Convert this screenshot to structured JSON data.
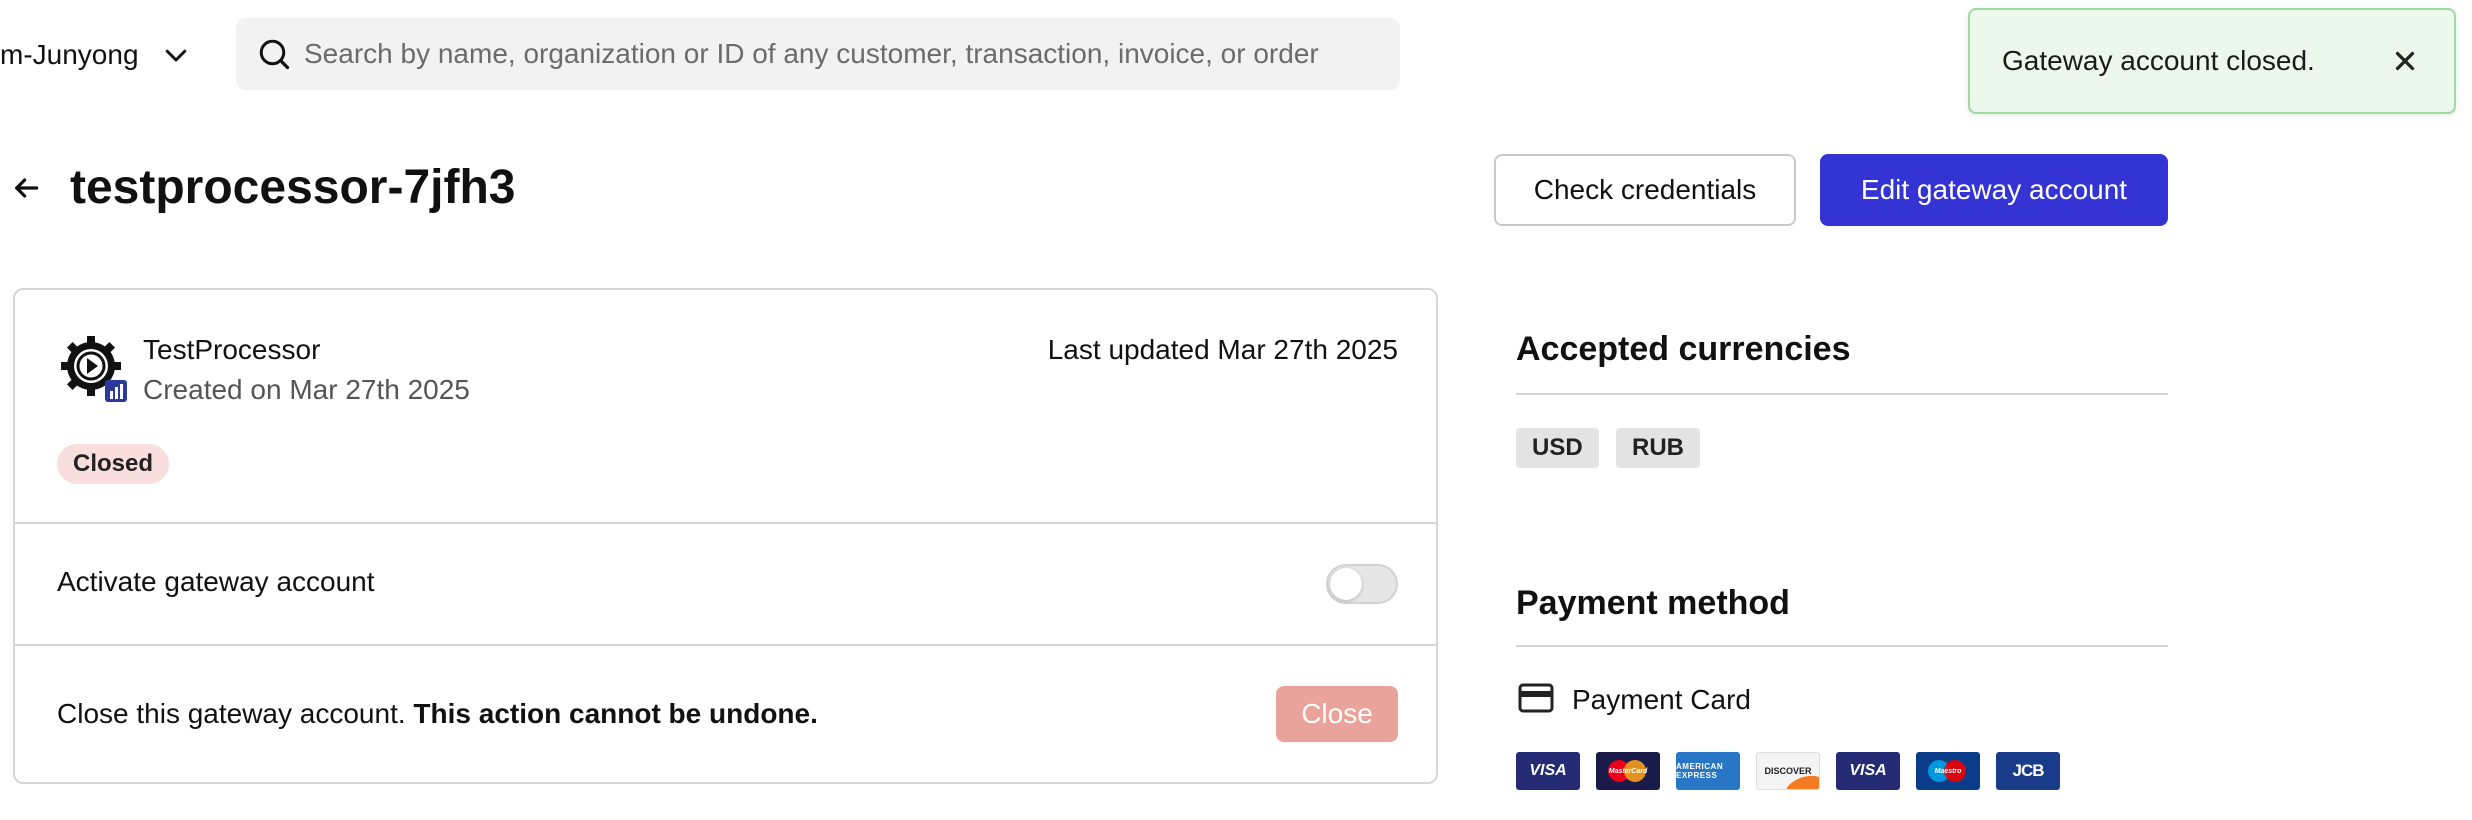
{
  "header": {
    "org_name": "m-Junyong",
    "search": {
      "placeholder": "Search by name, organization or ID of any customer, transaction, invoice, or order",
      "value": ""
    }
  },
  "toast": {
    "message": "Gateway account closed."
  },
  "page": {
    "title": "testprocessor-7jfh3",
    "check_credentials_label": "Check credentials",
    "edit_gateway_label": "Edit gateway account"
  },
  "gateway": {
    "processor_name": "TestProcessor",
    "created": "Created on Mar 27th 2025",
    "last_updated": "Last updated Mar 27th 2025",
    "status": "Closed",
    "activate_label": "Activate gateway account",
    "activate_enabled": false,
    "close_text": "Close this gateway account.",
    "close_warning": "This action cannot be undone.",
    "close_button_label": "Close"
  },
  "sidebar": {
    "currencies_heading": "Accepted currencies",
    "currencies": [
      "USD",
      "RUB"
    ],
    "payment_heading": "Payment method",
    "payment_method": "Payment Card",
    "card_brands": [
      {
        "name": "visa-icon",
        "label": "VISA"
      },
      {
        "name": "mastercard-icon",
        "label": "MasterCard"
      },
      {
        "name": "amex-icon",
        "label": "AMERICAN EXPRESS"
      },
      {
        "name": "discover-icon",
        "label": "DISCOVER"
      },
      {
        "name": "visa-icon",
        "label": "VISA"
      },
      {
        "name": "maestro-icon",
        "label": "Maestro"
      },
      {
        "name": "jcb-icon",
        "label": "JCB"
      }
    ]
  },
  "colors": {
    "primary": "#3434d4",
    "toast_bg": "#ecf8ec",
    "status_closed_bg": "#f9dede",
    "close_button": "#e9a39a"
  }
}
